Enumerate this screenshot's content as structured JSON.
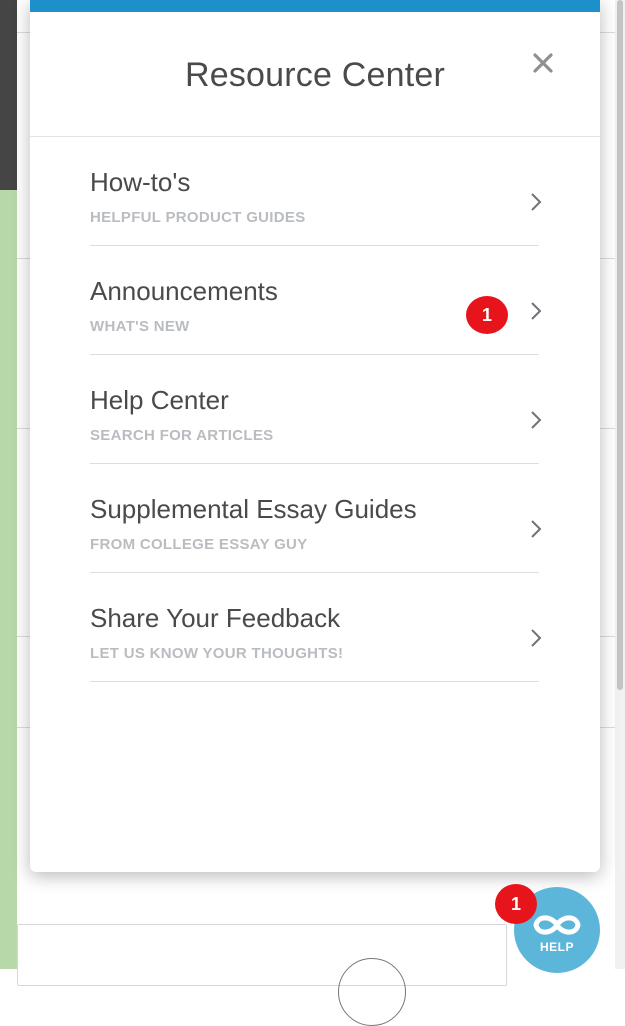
{
  "panel": {
    "title": "Resource Center",
    "close_icon": "close-icon",
    "accent_color": "#1d8fc9"
  },
  "menu": {
    "items": [
      {
        "title": "How-to's",
        "subtitle": "HELPFUL PRODUCT GUIDES",
        "badge": ""
      },
      {
        "title": "Announcements",
        "subtitle": "WHAT'S NEW",
        "badge": "1"
      },
      {
        "title": "Help Center",
        "subtitle": "SEARCH FOR ARTICLES",
        "badge": ""
      },
      {
        "title": "Supplemental Essay Guides",
        "subtitle": "FROM COLLEGE ESSAY GUY",
        "badge": ""
      },
      {
        "title": "Share Your Feedback",
        "subtitle": "LET US KNOW YOUR THOUGHTS!",
        "badge": ""
      }
    ],
    "chevron_icon": "chevron-right-icon"
  },
  "help_launcher": {
    "label": "HELP",
    "badge": "1",
    "icon": "infinity-logo-icon",
    "color": "#5cb6da",
    "badge_color": "#e8141b"
  }
}
